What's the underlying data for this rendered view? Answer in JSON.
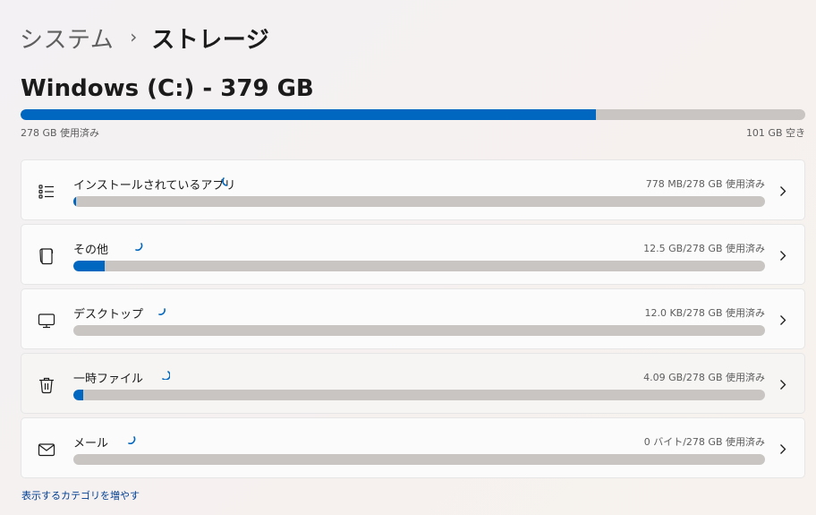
{
  "breadcrumb": {
    "parent": "システム",
    "separator": "›",
    "current": "ストレージ"
  },
  "drive": {
    "title": "Windows (C:) - 379 GB",
    "used_label": "278 GB 使用済み",
    "free_label": "101 GB 空き",
    "used_fraction": 0.733,
    "accent_color": "#0067c0",
    "track_color": "#c8c5c3"
  },
  "categories": [
    {
      "label": "インストールされているアプリ",
      "size": "778 MB/278 GB 使用済み",
      "used_fraction": 0.003,
      "icon": "apps-list-icon"
    },
    {
      "label": "その他",
      "size": "12.5 GB/278 GB 使用済み",
      "used_fraction": 0.045,
      "icon": "other-files-icon"
    },
    {
      "label": "デスクトップ",
      "size": "12.0 KB/278 GB 使用済み",
      "used_fraction": 0.0,
      "icon": "desktop-monitor-icon"
    },
    {
      "label": "一時ファイル",
      "size": "4.09 GB/278 GB 使用済み",
      "used_fraction": 0.014,
      "icon": "trash-icon"
    },
    {
      "label": "メール",
      "size": "0 バイト/278 GB 使用済み",
      "used_fraction": 0.0,
      "icon": "mail-icon"
    }
  ],
  "more_link": "表示するカテゴリを増やす"
}
